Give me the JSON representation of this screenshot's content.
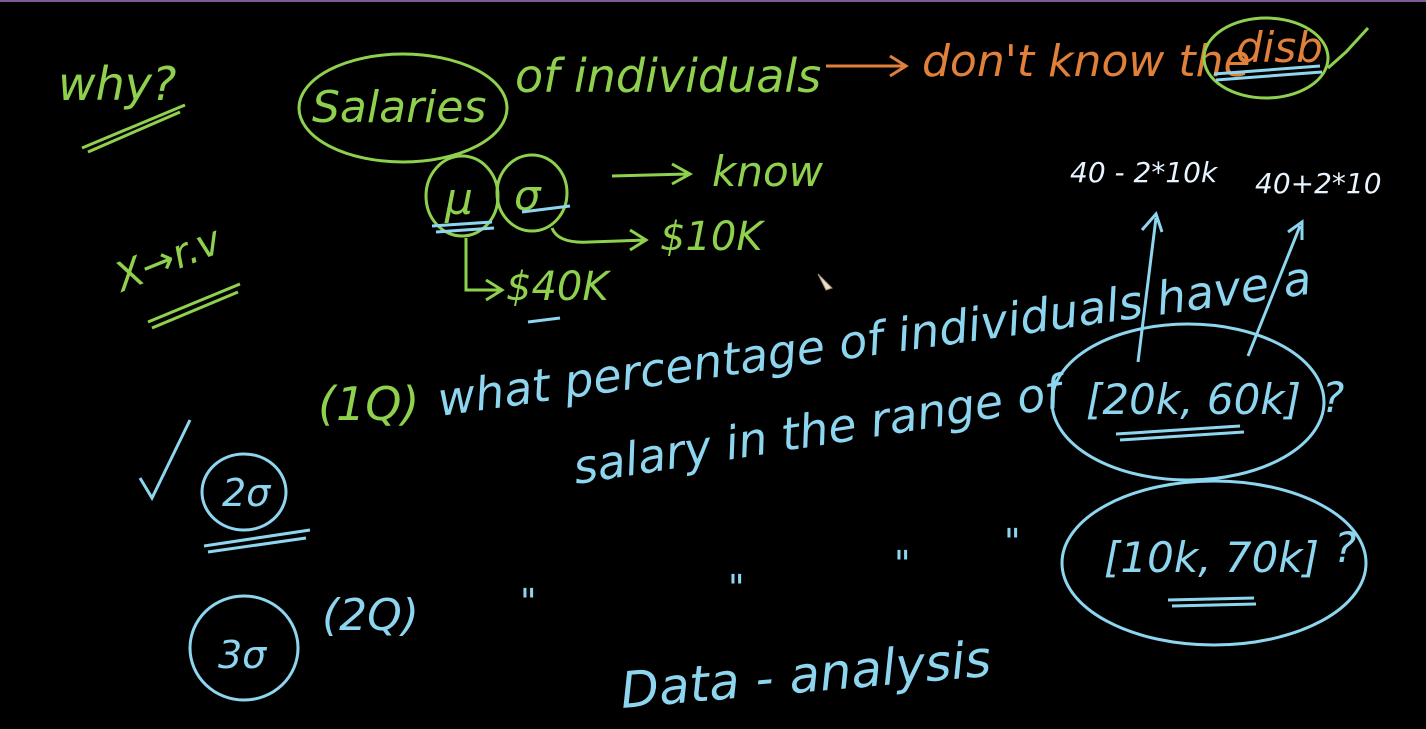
{
  "colors": {
    "background": "#000000",
    "green": "#8fd14f",
    "orange": "#e0803a",
    "blue": "#8ed6ef",
    "white": "#e8f4ff",
    "top_border": "#7a5a9a"
  },
  "board": {
    "why": "why?",
    "x_rv": "X→r.v",
    "salaries": "Salaries",
    "of_individuals": "of individuals",
    "dont_know": "don't know the",
    "disb": "disb",
    "mu": "μ",
    "sigma": "σ",
    "know": "know",
    "val_10k": "$10K",
    "val_40k": "$40K",
    "low_calc": "40 - 2*10k",
    "high_calc": "40+2*10",
    "q1_num": "(1Q)",
    "q1_line1": "what percentage of individuals have a",
    "q1_line2": "salary in the range of",
    "range_1": "[20k, 60k]",
    "q_mark_1": "?",
    "two_sigma": "2σ",
    "three_sigma": "3σ",
    "q2_num": "(2Q)",
    "ditto": "\"",
    "range_2": "[10k, 70k]",
    "q_mark_2": "?",
    "data_analysis": "Data - analysis"
  },
  "icons": [
    "checkmark-icon",
    "pencil-cursor-icon",
    "arrow-icon"
  ]
}
